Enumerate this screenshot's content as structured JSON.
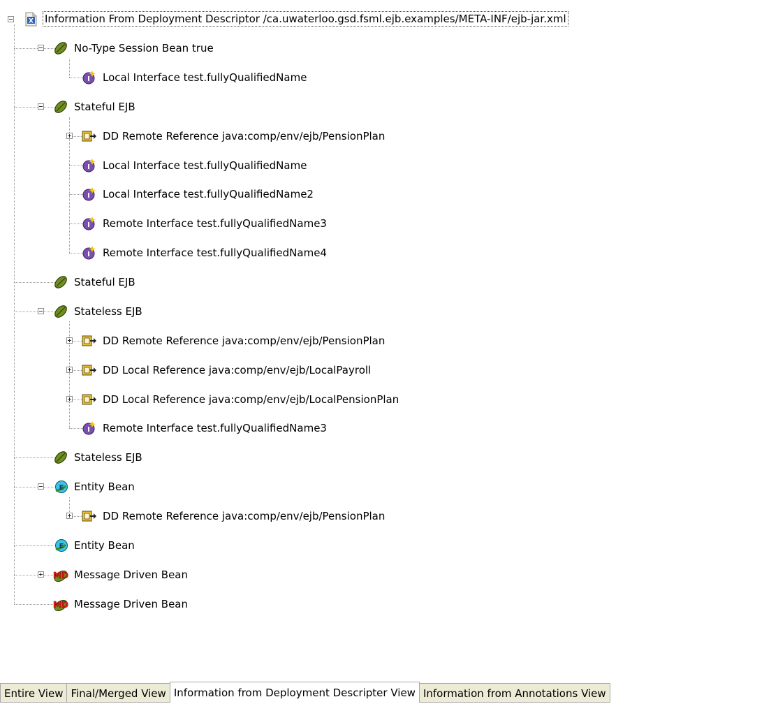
{
  "tree": {
    "root": {
      "label": "Information From Deployment Descriptor /ca.uwaterloo.gsd.fsml.ejb.examples/META-INF/ejb-jar.xml",
      "icon": "xml-file-icon",
      "expanded": true
    },
    "nodes": [
      {
        "label": "No-Type Session Bean true",
        "icon": "session-bean-icon",
        "expanded": true
      },
      {
        "label": "Local Interface test.fullyQualifiedName",
        "icon": "interface-icon"
      },
      {
        "label": "Stateful EJB",
        "icon": "session-bean-icon",
        "expanded": true
      },
      {
        "label": "DD Remote Reference java:comp/env/ejb/PensionPlan",
        "icon": "reference-icon",
        "expanded": false
      },
      {
        "label": "Local Interface test.fullyQualifiedName",
        "icon": "interface-icon"
      },
      {
        "label": "Local Interface test.fullyQualifiedName2",
        "icon": "interface-icon"
      },
      {
        "label": "Remote Interface test.fullyQualifiedName3",
        "icon": "interface-icon"
      },
      {
        "label": "Remote Interface test.fullyQualifiedName4",
        "icon": "interface-icon"
      },
      {
        "label": "Stateful EJB",
        "icon": "session-bean-icon"
      },
      {
        "label": "Stateless EJB",
        "icon": "session-bean-icon",
        "expanded": true
      },
      {
        "label": "DD Remote Reference java:comp/env/ejb/PensionPlan",
        "icon": "reference-icon",
        "expanded": false
      },
      {
        "label": "DD Local Reference java:comp/env/ejb/LocalPayroll",
        "icon": "reference-icon",
        "expanded": false
      },
      {
        "label": "DD Local Reference java:comp/env/ejb/LocalPensionPlan",
        "icon": "reference-icon",
        "expanded": false
      },
      {
        "label": "Remote Interface test.fullyQualifiedName3",
        "icon": "interface-icon"
      },
      {
        "label": "Stateless EJB",
        "icon": "session-bean-icon"
      },
      {
        "label": "Entity Bean",
        "icon": "entity-bean-icon",
        "expanded": true
      },
      {
        "label": "DD Remote Reference java:comp/env/ejb/PensionPlan",
        "icon": "reference-icon",
        "expanded": false
      },
      {
        "label": "Entity Bean",
        "icon": "entity-bean-icon"
      },
      {
        "label": "Message Driven Bean",
        "icon": "message-driven-bean-icon",
        "expanded": false
      },
      {
        "label": "Message Driven Bean",
        "icon": "message-driven-bean-icon"
      }
    ]
  },
  "tabs": [
    {
      "label": "Entire View",
      "active": false
    },
    {
      "label": "Final/Merged View",
      "active": false
    },
    {
      "label": "Information from Deployment Descripter View",
      "active": true
    },
    {
      "label": "Information from Annotations View",
      "active": false
    }
  ],
  "colors": {
    "tab_inactive": "#ecebd6",
    "tab_active": "#ffffff",
    "guide_line": "#9a9a9a"
  }
}
